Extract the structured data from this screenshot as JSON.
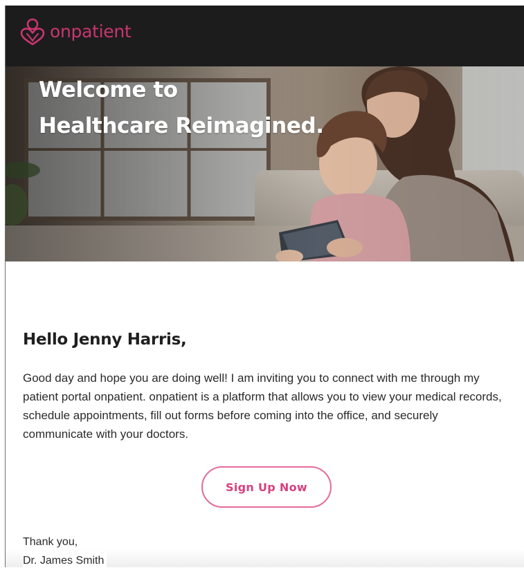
{
  "brand": {
    "name": "onpatient",
    "logo_icon": "onpatient-logo-icon",
    "accent_color": "#c8366f"
  },
  "hero": {
    "title_line1": "Welcome to",
    "title_line2": "Healthcare Reimagined."
  },
  "email": {
    "greeting": "Hello Jenny Harris,",
    "body": "Good day and hope you are doing well! I am inviting you to connect with me through my patient portal onpatient. onpatient is a platform that allows you to view your medical records, schedule appointments, fill out forms before coming into the office, and securely communicate with your doctors.",
    "cta_label": "Sign Up Now",
    "cta_color": "#e46a9b",
    "closing": "Thank you,",
    "signature": "Dr. James Smith"
  }
}
